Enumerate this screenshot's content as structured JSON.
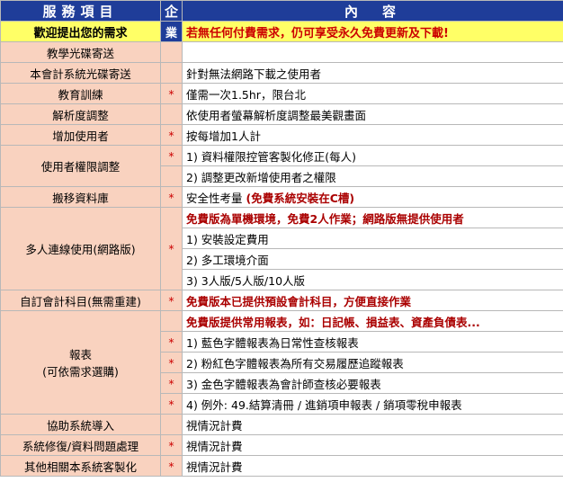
{
  "header": {
    "service": "服務項目",
    "company_line1": "企",
    "company_line2": "業",
    "content": "內　容"
  },
  "subheader": {
    "left": "歡迎提出您的需求",
    "right": "若無任何付費需求，仍可享受永久免費更新及下載!"
  },
  "rows": {
    "r1": {
      "name": "教學光碟寄送",
      "star": "",
      "content": ""
    },
    "r2": {
      "name": "本會計系統光碟寄送",
      "star": "",
      "content": "針對無法網路下載之使用者"
    },
    "r3": {
      "name": "教育訓練",
      "star": "*",
      "content": "僅需一次1.5hr，限台北"
    },
    "r4": {
      "name": "解析度調整",
      "star": "",
      "content": "依使用者螢幕解析度調整最美觀畫面"
    },
    "r5": {
      "name": "增加使用者",
      "star": "*",
      "content": "按每增加1人計"
    },
    "r6": {
      "name": "使用者權限調整",
      "star1": "*",
      "c1": "1) 資料權限控管客製化修正(每人)",
      "star2": "",
      "c2": "2) 調整更改新增使用者之權限"
    },
    "r7": {
      "name": "搬移資料庫",
      "star": "*",
      "content": "安全性考量 ",
      "content_bold": "(免費系統安裝在C槽)"
    },
    "r8": {
      "name": "多人連線使用(網路版)",
      "star": "*",
      "c0": "免費版為單機環境，免費2人作業；網路版無提供使用者",
      "c1": "1) 安裝設定費用",
      "c2": "2) 多工環境介面",
      "c3": "3) 3人版/5人版/10人版"
    },
    "r9": {
      "name": "自訂會計科目(無需重建)",
      "star": "*",
      "content": "免費版本已提供預設會計科目，方便直接作業"
    },
    "r10": {
      "name_line1": "報表",
      "name_line2": "(可依需求選購)",
      "c0": "免費版提供常用報表，如：日記帳、損益表、資產負債表...",
      "c1": "1) 藍色字體報表為日常性查核報表",
      "c2": "2) 粉紅色字體報表為所有交易履歷追蹤報表",
      "c3": "3) 金色字體報表為會計師查核必要報表",
      "c4": "4) 例外: 49.結算清冊 / 進銷項申報表 / 銷項零稅申報表",
      "star": "*"
    },
    "r11": {
      "name": "協助系統導入",
      "star": "",
      "content": "視情況計費"
    },
    "r12": {
      "name": "系統修復/資料問題處理",
      "star": "*",
      "content": "視情況計費"
    },
    "r13": {
      "name": "其他相關本系統客製化",
      "star": "*",
      "content": "視情況計費"
    }
  }
}
